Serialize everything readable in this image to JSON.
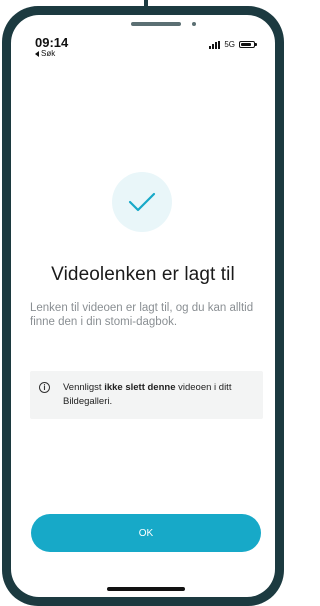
{
  "status_bar": {
    "time": "09:14",
    "back_label": "Søk",
    "network": "5G"
  },
  "confirmation": {
    "icon": "check-icon",
    "title": "Videolenken er lagt til",
    "description": "Lenken til videoen er lagt til, og du kan alltid finne den i din stomi-dagbok."
  },
  "notice": {
    "icon": "info-icon",
    "text_before": "Vennligst ",
    "text_bold": "ikke slett denne",
    "text_after": " videoen i ditt Bildegalleri."
  },
  "actions": {
    "ok_label": "OK"
  },
  "colors": {
    "accent": "#17a9c8",
    "frame": "#1c3a40",
    "check_bg": "#e9f6f9"
  }
}
